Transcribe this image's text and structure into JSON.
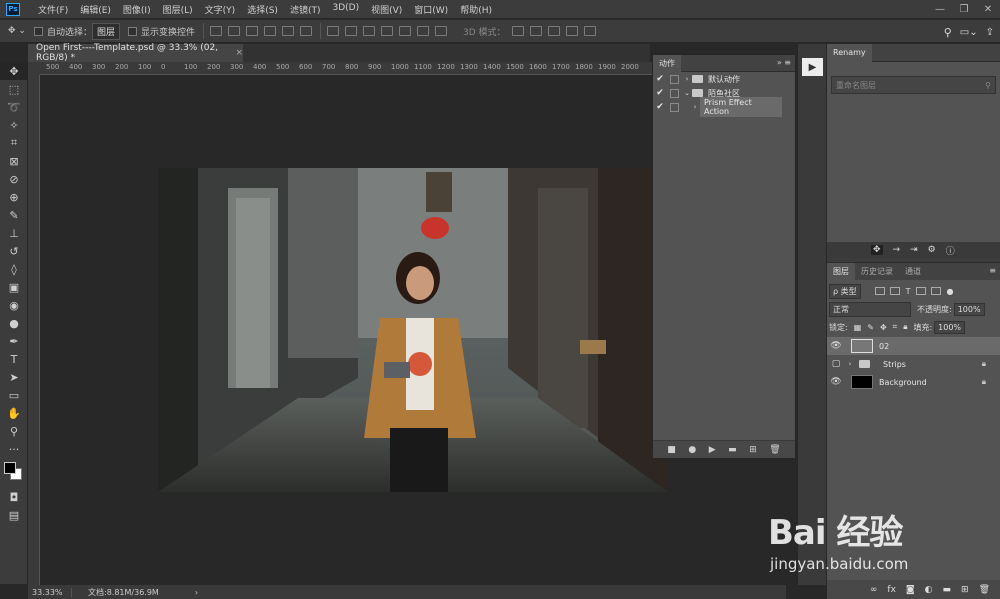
{
  "menu": {
    "logo": "Ps",
    "items": [
      "文件(F)",
      "编辑(E)",
      "图像(I)",
      "图层(L)",
      "文字(Y)",
      "选择(S)",
      "滤镜(T)",
      "3D(D)",
      "视图(V)",
      "窗口(W)",
      "帮助(H)"
    ]
  },
  "options": {
    "auto_select_label": "自动选择：",
    "auto_select_value": "图层",
    "show_transform_label": "显示变换控件",
    "mode3d_label": "3D 模式："
  },
  "document": {
    "tab_title": "Open First----Template.psd @ 33.3% (02, RGB/8) *",
    "close": "×",
    "ruler_ticks": [
      "500",
      "400",
      "300",
      "200",
      "100",
      "0",
      "100",
      "200",
      "300",
      "400",
      "500",
      "600",
      "700",
      "800",
      "900",
      "1000",
      "1100",
      "1200",
      "1300",
      "1400",
      "1500",
      "1600",
      "1700",
      "1800",
      "1900",
      "2000"
    ]
  },
  "status": {
    "zoom": "33.33%",
    "doc_info": "文档:8.81M/36.9M",
    "arrow": "›"
  },
  "actions_panel": {
    "tab": "动作",
    "rows": [
      {
        "check": "✔",
        "label": "默认动作"
      },
      {
        "check": "✔",
        "label": "陌鱼社区"
      },
      {
        "check": "✔",
        "label": "Prism Effect Action"
      }
    ]
  },
  "renamy": {
    "tab": "Renamy",
    "search_placeholder": "重命名图层"
  },
  "layers_panel": {
    "tabs": [
      "图层",
      "历史记录",
      "通道"
    ],
    "filter_kind": "ρ 类型",
    "blend_mode": "正常",
    "opacity_label": "不透明度:",
    "opacity_value": "100%",
    "lock_label": "锁定:",
    "fill_label": "填充:",
    "fill_value": "100%",
    "layers": [
      {
        "name": "02",
        "visible": true
      },
      {
        "name": "Strips",
        "visible": false
      },
      {
        "name": "Background",
        "visible": true
      }
    ]
  },
  "watermark": {
    "brand": "Bai 经验",
    "url": "jingyan.baidu.com"
  },
  "colors": {
    "panel": "#535353",
    "chrome": "#3c3c3c",
    "canvas": "#282828",
    "ps_blue": "#31a8ff"
  }
}
